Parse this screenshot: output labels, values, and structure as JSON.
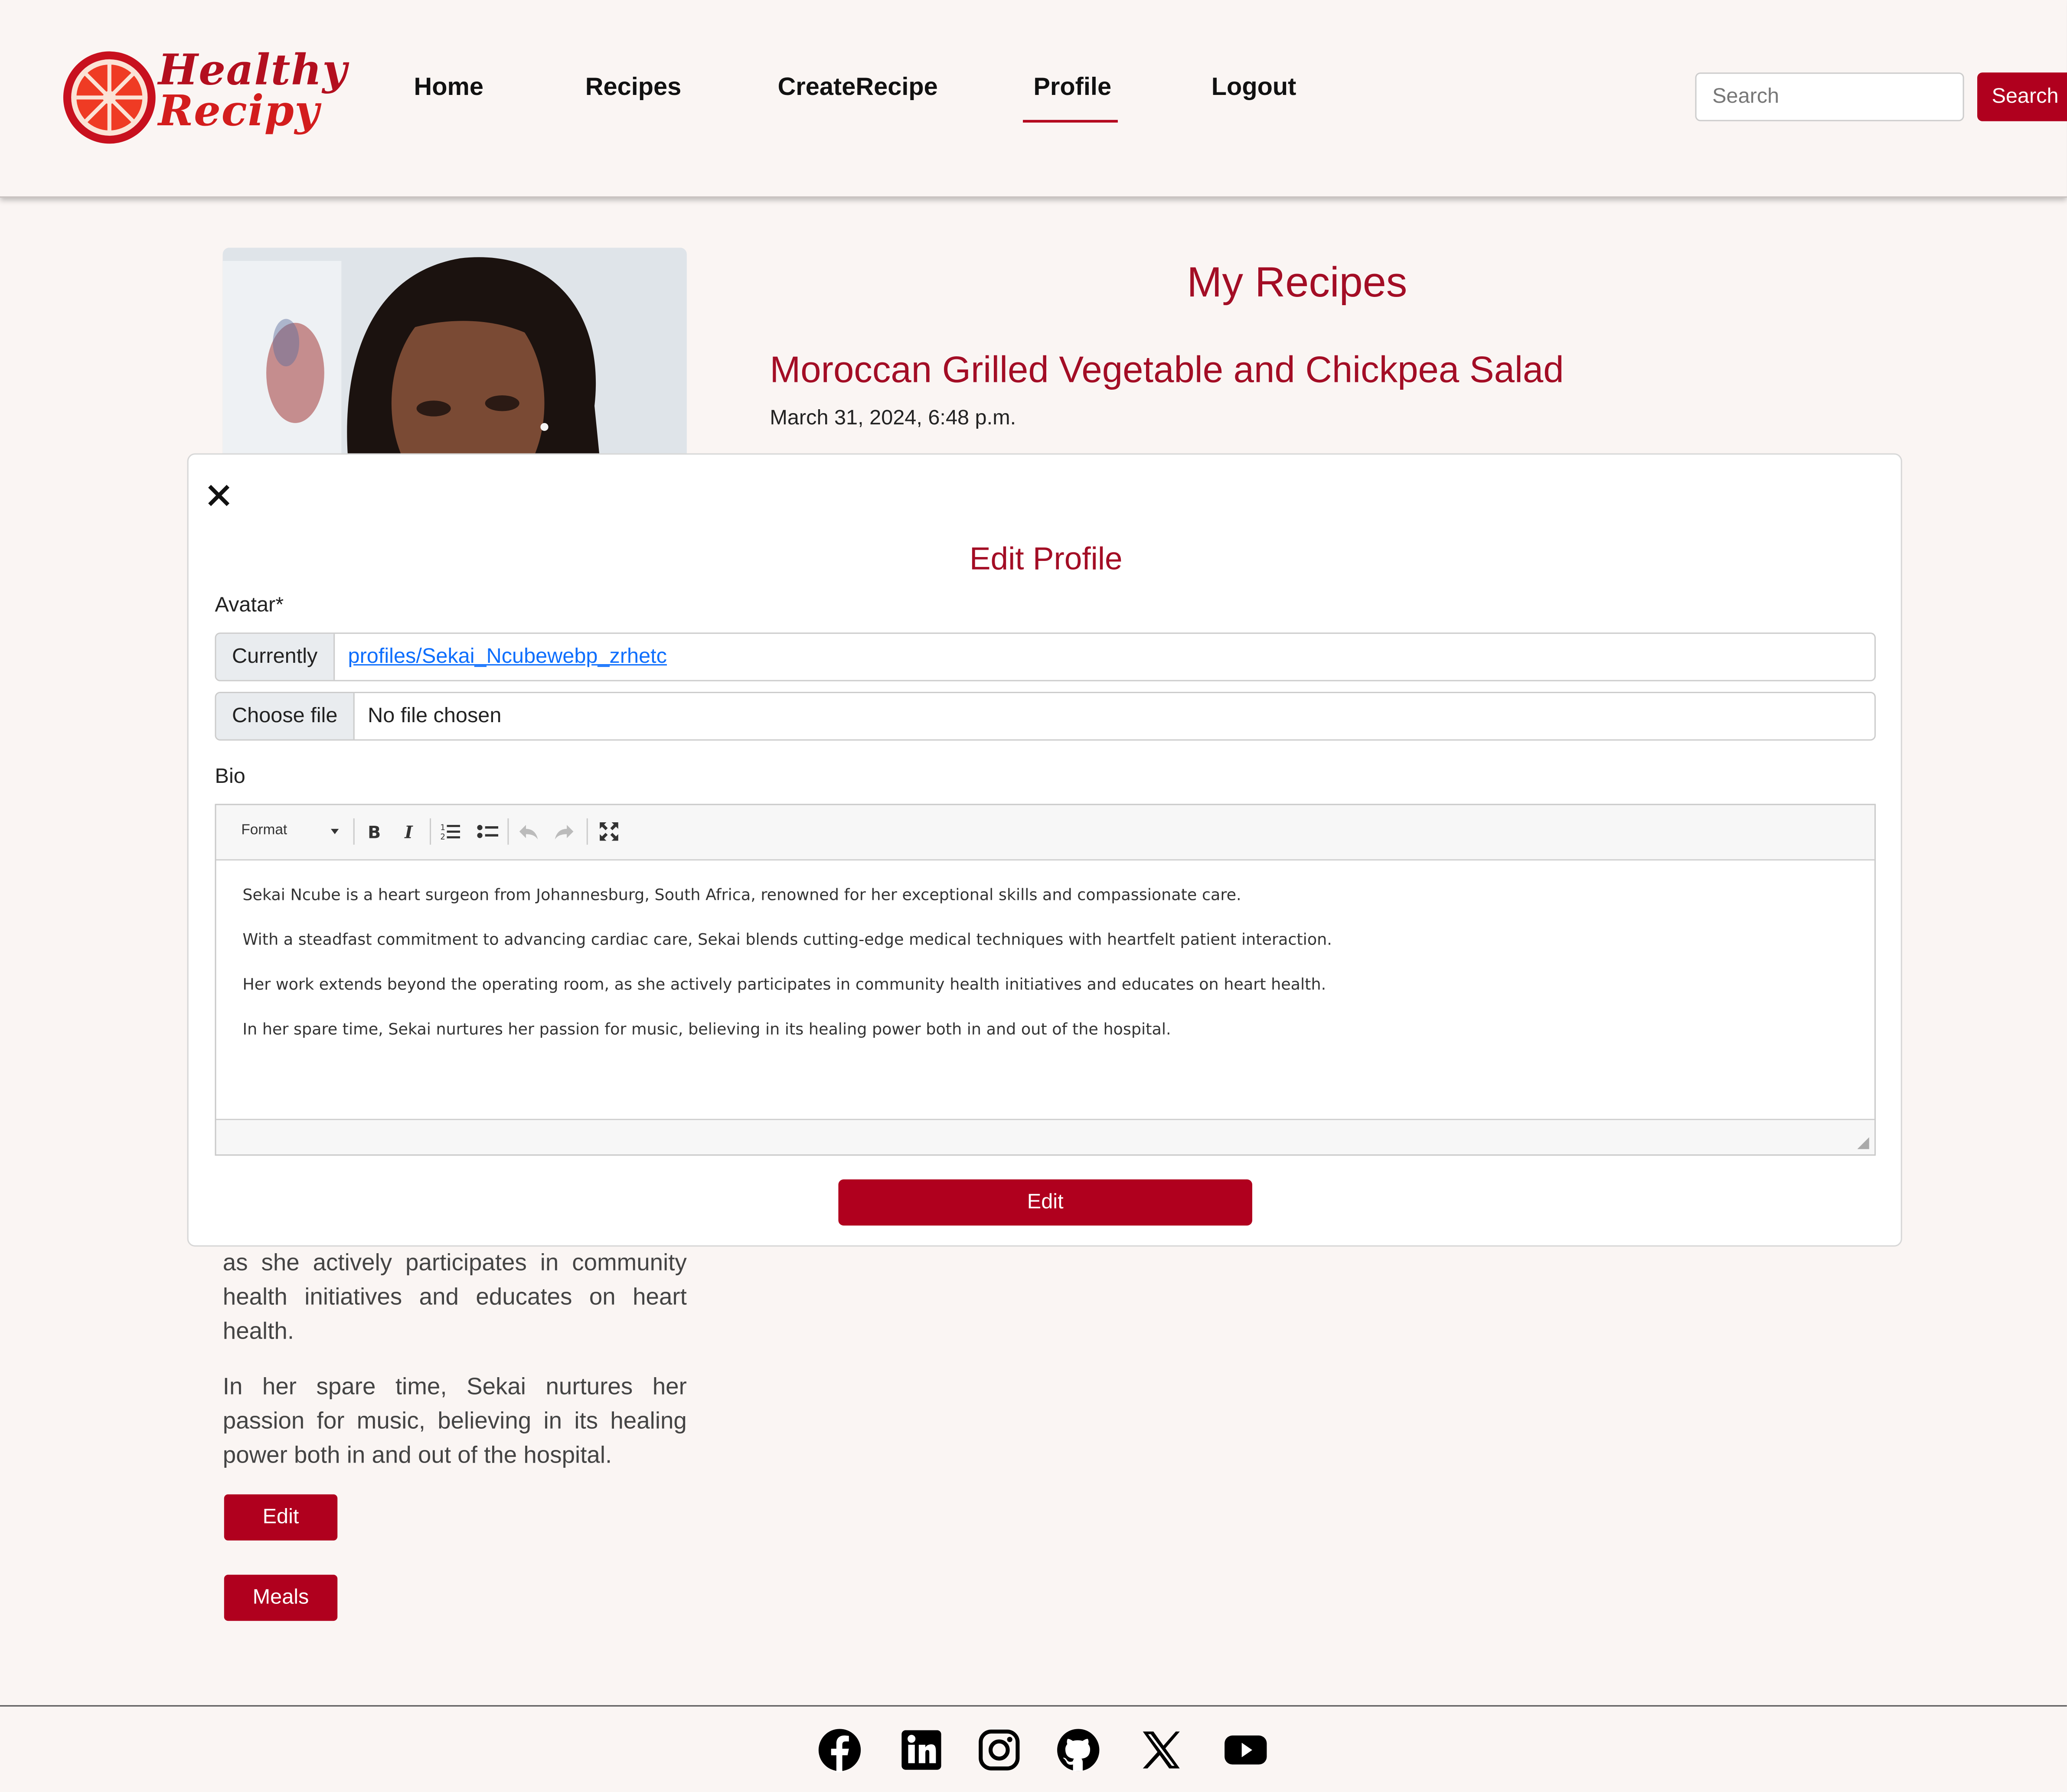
{
  "header": {
    "logo_line1": "Healthy",
    "logo_line2": "Recipy",
    "nav": [
      "Home",
      "Recipes",
      "CreateRecipe",
      "Profile",
      "Logout"
    ],
    "active_nav": "Profile",
    "search_placeholder": "Search",
    "search_button": "Search"
  },
  "profile": {
    "bio_visible": [
      "as she actively participates in community health initiatives and educates on heart health.",
      "In her spare time, Sekai nurtures her passion for music, believing in its healing power both in and out of the hospital."
    ],
    "edit_button": "Edit",
    "meals_button": "Meals"
  },
  "recipes": {
    "heading": "My Recipes",
    "items": [
      {
        "title": "Moroccan Grilled Vegetable and Chickpea Salad",
        "date": "March 31, 2024, 6:48 p.m."
      }
    ]
  },
  "modal": {
    "title": "Edit Profile",
    "avatar_label": "Avatar*",
    "currently_label": "Currently",
    "currently_value": "profiles/Sekai_Ncubewebp_zrhetc",
    "choose_file_label": "Choose file",
    "file_status": "No file chosen",
    "bio_label": "Bio",
    "toolbar": {
      "format_label": "Format",
      "icons": [
        "bold-icon",
        "italic-icon",
        "numbered-list-icon",
        "bulleted-list-icon",
        "undo-icon",
        "redo-icon",
        "maximize-icon"
      ]
    },
    "bio_paragraphs": [
      "Sekai Ncube is a heart surgeon from Johannesburg, South Africa, renowned for her exceptional skills and compassionate care.",
      "With a steadfast commitment to advancing cardiac care, Sekai blends cutting-edge medical techniques with heartfelt patient interaction.",
      "Her work extends beyond the operating room, as she actively participates in community health initiatives and educates on heart health.",
      "In her spare time, Sekai nurtures her passion for music, believing in its healing power both in and out of the hospital."
    ],
    "submit_label": "Edit"
  },
  "footer": {
    "social_icons": [
      "facebook-icon",
      "linkedin-icon",
      "instagram-icon",
      "github-icon",
      "x-icon",
      "youtube-icon"
    ]
  },
  "colors": {
    "accent": "#b0001e",
    "heading": "#a30d25",
    "background": "#faf5f3"
  }
}
